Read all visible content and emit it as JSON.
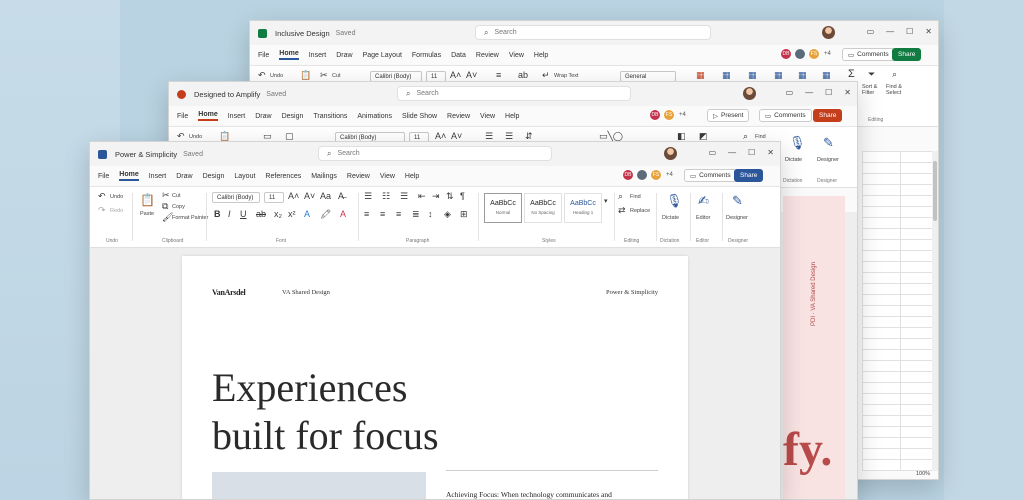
{
  "excel": {
    "title": "Inclusive Design",
    "saved": "Saved",
    "search_placeholder": "Search",
    "menu": [
      "File",
      "Home",
      "Insert",
      "Draw",
      "Page Layout",
      "Formulas",
      "Data",
      "Review",
      "View",
      "Help"
    ],
    "plus_count": "+4",
    "comments_label": "Comments",
    "share_label": "Share",
    "undo_label": "Undo",
    "cut_label": "Cut",
    "font_name": "Calibri (Body)",
    "font_size": "11",
    "wrap_text": "Wrap Text",
    "number_format": "General",
    "sort_filter": "Sort & Filter",
    "find_select": "Find & Select",
    "editing_label": "Editing",
    "zoom": "100%",
    "accent": "#107c41"
  },
  "powerpoint": {
    "title": "Designed to Amplify",
    "saved": "Saved",
    "search_placeholder": "Search",
    "menu": [
      "File",
      "Home",
      "Insert",
      "Draw",
      "Design",
      "Transitions",
      "Animations",
      "Slide Show",
      "Review",
      "View",
      "Help"
    ],
    "plus_count": "+4",
    "present_label": "Present",
    "comments_label": "Comments",
    "share_label": "Share",
    "undo_label": "Undo",
    "font_name": "Calibri (Body)",
    "font_size": "11",
    "find_label": "Find",
    "dictate_label": "Dictate",
    "designer_label": "Designer",
    "dictation_group": "Dictation",
    "designer_group": "Designer",
    "slide_vertical": "PDI · VA Shared Design",
    "slide_big_text": "fy.",
    "accent": "#c43e1c"
  },
  "word": {
    "title": "Power & Simplicity",
    "saved": "Saved",
    "search_placeholder": "Search",
    "menu": [
      "File",
      "Home",
      "Insert",
      "Draw",
      "Design",
      "Layout",
      "References",
      "Mailings",
      "Review",
      "View",
      "Help"
    ],
    "plus_count": "+4",
    "comments_label": "Comments",
    "share_label": "Share",
    "undo_label": "Undo",
    "redo_label": "Redo",
    "paste_label": "Paste",
    "cut_label": "Cut",
    "copy_label": "Copy",
    "format_painter_label": "Format Painter",
    "font_name": "Calibri (Body)",
    "font_size": "11",
    "styles": [
      {
        "sample": "AaBbCc",
        "name": "Normal"
      },
      {
        "sample": "AaBbCc",
        "name": "No Spacing"
      },
      {
        "sample": "AaBbCc",
        "name": "Heading 1"
      }
    ],
    "find_label": "Find",
    "replace_label": "Replace",
    "dictate_label": "Dictate",
    "editor_label": "Editor",
    "designer_label": "Designer",
    "groups": {
      "undo": "Undo",
      "clipboard": "Clipboard",
      "font": "Font",
      "paragraph": "Paragraph",
      "styles": "Styles",
      "editing": "Editing",
      "dictation": "Dictation",
      "editor": "Editor",
      "designer": "Designer"
    },
    "doc": {
      "brand": "VanArsdel",
      "header_center": "VA Shared Design",
      "header_right": "Power & Simplicity",
      "headline_1": "Experiences",
      "headline_2": "built for focus",
      "body_start": "Achieving Focus: When technology communicates and"
    },
    "accent": "#2b579a"
  }
}
